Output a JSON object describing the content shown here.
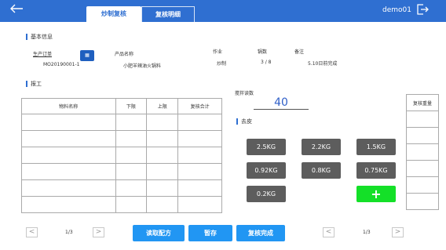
{
  "header": {
    "back_icon": "arrow-left-icon",
    "tabs": [
      {
        "label": "炒制复核",
        "active": true
      },
      {
        "label": "复核明细",
        "active": false
      }
    ],
    "user": "demo01",
    "logout_icon": "logout-icon"
  },
  "basic_info": {
    "section_title": "基本信息",
    "production_order_label": "生产订单",
    "production_order_value": "MO20190001-1",
    "product_name_label": "产品名称",
    "product_name_value": "小肥羊辣油火锅料",
    "operation_label": "作业",
    "operation_value": "炒制",
    "batch_label": "锅数",
    "batch_value": "3 / 8",
    "remark_label": "备注",
    "remark_value": "5.10日前完成"
  },
  "report": {
    "section_title": "报工",
    "columns": [
      "物料名称",
      "下限",
      "上限",
      "复核合计"
    ],
    "rows": 6,
    "pager": {
      "prev": "<",
      "page": "1/3",
      "next": ">"
    }
  },
  "stir_count": {
    "label": "搅拌读数",
    "value": "40"
  },
  "tare": {
    "section_title": "去皮",
    "buttons": [
      "2.5KG",
      "2.2KG",
      "1.5KG",
      "0.92KG",
      "0.8KG",
      "0.75KG",
      "0.2KG"
    ],
    "add_label": "+"
  },
  "recheck_weight": {
    "column": "复核重量",
    "rows": 6,
    "pager": {
      "prev": "<",
      "page": "1/3",
      "next": ">"
    }
  },
  "actions": {
    "read_recipe": "读取配方",
    "hold": "暂存",
    "complete": "复核完成"
  },
  "colors": {
    "primary": "#2f6fd1",
    "action": "#2196f3",
    "weight_button": "#5d5d5d",
    "add_button": "#14e028",
    "value_text": "#2f5fc8"
  }
}
